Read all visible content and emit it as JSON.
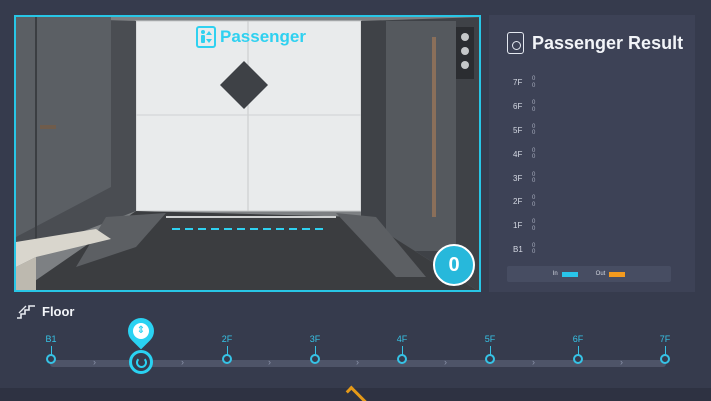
{
  "camera": {
    "title": "Passenger",
    "count": "0",
    "accent": "#28c6e6"
  },
  "result": {
    "title": "Passenger Result",
    "floors": [
      {
        "label": "7F",
        "in": "0",
        "out": "0"
      },
      {
        "label": "6F",
        "in": "0",
        "out": "0"
      },
      {
        "label": "5F",
        "in": "0",
        "out": "0"
      },
      {
        "label": "4F",
        "in": "0",
        "out": "0"
      },
      {
        "label": "3F",
        "in": "0",
        "out": "0"
      },
      {
        "label": "2F",
        "in": "0",
        "out": "0"
      },
      {
        "label": "1F",
        "in": "0",
        "out": "0"
      },
      {
        "label": "B1",
        "in": "0",
        "out": "0"
      }
    ],
    "legend": {
      "in_label": "In",
      "out_label": "Out",
      "in_color": "#29c5ea",
      "out_color": "#f39a1e"
    }
  },
  "floor_bar": {
    "title": "Floor",
    "stops": [
      "B1",
      "2F",
      "3F",
      "4F",
      "5F",
      "6F",
      "7F"
    ],
    "current_icon": "elevator-updown-icon"
  }
}
